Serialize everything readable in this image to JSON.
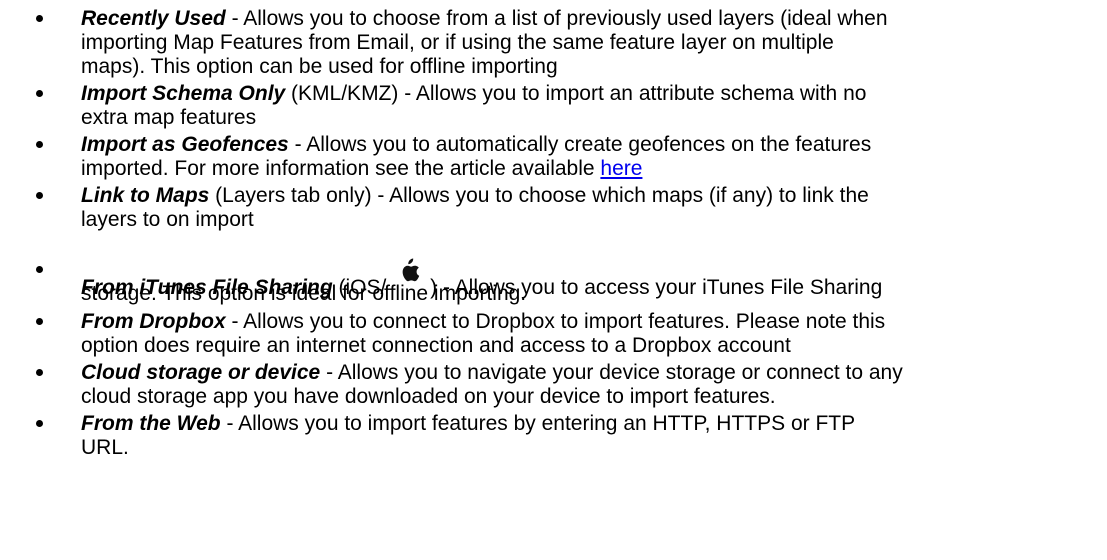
{
  "items": [
    {
      "term": "Recently Used",
      "lines": [
        " - Allows you to choose from a list of previously used layers (ideal when",
        "importing Map Features from Email, or if using the same feature layer on multiple",
        "maps).  This option can be used for offline importing"
      ]
    },
    {
      "term": "Import Schema Only",
      "lines": [
        " (KML/KMZ) - Allows you to import an attribute schema with no",
        "extra map features"
      ]
    },
    {
      "term": "Import as Geofences",
      "lines": [
        " - Allows you to automatically create geofences on the features",
        "imported.  For more information see the article available "
      ],
      "link_text": "here"
    },
    {
      "term": "Link to Maps",
      "lines": [
        " (Layers tab only) - Allows you to choose which maps (if any) to link the",
        "layers to on import"
      ]
    },
    {
      "term": "From iTunes File Sharing",
      "inline_before_icon": " (iOS/ ",
      "icon": "apple-logo-icon",
      "lines": [
        ") - Allows you to access your iTunes File Sharing",
        "storage. This option is ideal for offline importing."
      ]
    },
    {
      "term": "From Dropbox",
      "lines": [
        " - Allows you to connect to Dropbox to import features.  Please note this",
        "option does require an internet connection and access to a Dropbox account"
      ]
    },
    {
      "term": "Cloud storage or device",
      "lines": [
        " - Allows you to navigate your device storage or connect to any",
        "cloud storage app you have downloaded on your device to import features."
      ]
    },
    {
      "term": "From the Web",
      "lines": [
        " - Allows you to import features by entering an HTTP, HTTPS or FTP",
        "URL."
      ]
    }
  ],
  "colors": {
    "text": "#000000",
    "link": "#0000ee",
    "background": "#ffffff"
  }
}
